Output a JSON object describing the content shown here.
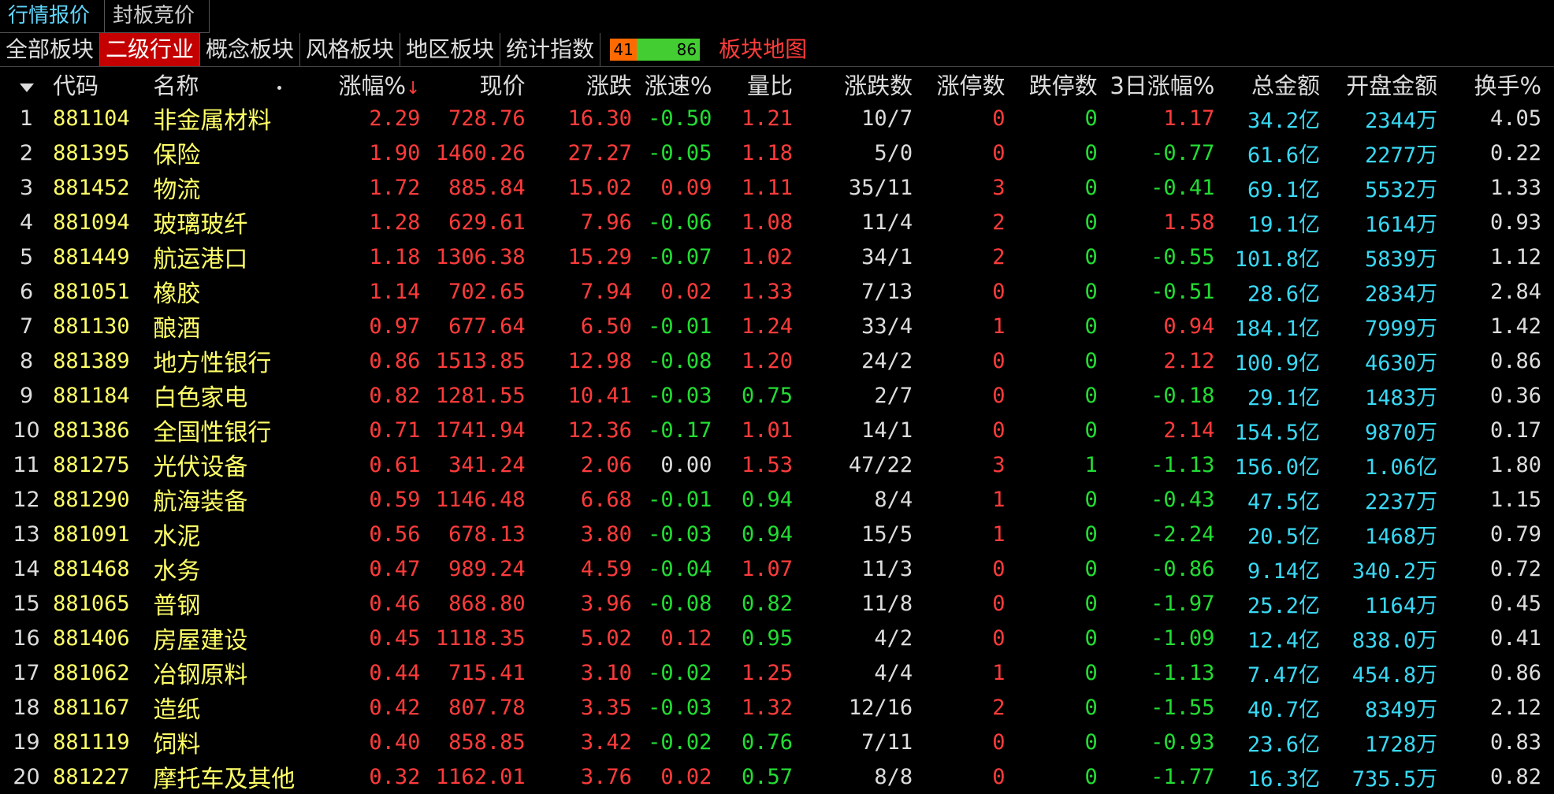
{
  "top_tabs": [
    "行情报价",
    "封板竞价"
  ],
  "sub_tabs": [
    "全部板块",
    "二级行业",
    "概念板块",
    "风格板块",
    "地区板块",
    "统计指数"
  ],
  "ratio": {
    "up": "41",
    "down": "86"
  },
  "heatmap_link": "板块地图",
  "headers": {
    "code": "代码",
    "name": "名称",
    "chg": "涨幅%",
    "sort_mark": "↓",
    "price": "现价",
    "diff": "涨跌",
    "speed": "涨速%",
    "vr": "量比",
    "ud": "涨跌数",
    "lu": "涨停数",
    "ld": "跌停数",
    "d3": "3日涨幅%",
    "amt": "总金额",
    "open": "开盘金额",
    "turn": "换手%"
  },
  "rows": [
    [
      "1",
      "881104",
      "非金属材料",
      "2.29",
      "728.76",
      "16.30",
      "-0.50",
      "1.21",
      "10/7",
      "0",
      "0",
      "1.17",
      "34.2亿",
      "2344万",
      "4.05"
    ],
    [
      "2",
      "881395",
      "保险",
      "1.90",
      "1460.26",
      "27.27",
      "-0.05",
      "1.18",
      "5/0",
      "0",
      "0",
      "-0.77",
      "61.6亿",
      "2277万",
      "0.22"
    ],
    [
      "3",
      "881452",
      "物流",
      "1.72",
      "885.84",
      "15.02",
      "0.09",
      "1.11",
      "35/11",
      "3",
      "0",
      "-0.41",
      "69.1亿",
      "5532万",
      "1.33"
    ],
    [
      "4",
      "881094",
      "玻璃玻纤",
      "1.28",
      "629.61",
      "7.96",
      "-0.06",
      "1.08",
      "11/4",
      "2",
      "0",
      "1.58",
      "19.1亿",
      "1614万",
      "0.93"
    ],
    [
      "5",
      "881449",
      "航运港口",
      "1.18",
      "1306.38",
      "15.29",
      "-0.07",
      "1.02",
      "34/1",
      "2",
      "0",
      "-0.55",
      "101.8亿",
      "5839万",
      "1.12"
    ],
    [
      "6",
      "881051",
      "橡胶",
      "1.14",
      "702.65",
      "7.94",
      "0.02",
      "1.33",
      "7/13",
      "0",
      "0",
      "-0.51",
      "28.6亿",
      "2834万",
      "2.84"
    ],
    [
      "7",
      "881130",
      "酿酒",
      "0.97",
      "677.64",
      "6.50",
      "-0.01",
      "1.24",
      "33/4",
      "1",
      "0",
      "0.94",
      "184.1亿",
      "7999万",
      "1.42"
    ],
    [
      "8",
      "881389",
      "地方性银行",
      "0.86",
      "1513.85",
      "12.98",
      "-0.08",
      "1.20",
      "24/2",
      "0",
      "0",
      "2.12",
      "100.9亿",
      "4630万",
      "0.86"
    ],
    [
      "9",
      "881184",
      "白色家电",
      "0.82",
      "1281.55",
      "10.41",
      "-0.03",
      "0.75",
      "2/7",
      "0",
      "0",
      "-0.18",
      "29.1亿",
      "1483万",
      "0.36"
    ],
    [
      "10",
      "881386",
      "全国性银行",
      "0.71",
      "1741.94",
      "12.36",
      "-0.17",
      "1.01",
      "14/1",
      "0",
      "0",
      "2.14",
      "154.5亿",
      "9870万",
      "0.17"
    ],
    [
      "11",
      "881275",
      "光伏设备",
      "0.61",
      "341.24",
      "2.06",
      "0.00",
      "1.53",
      "47/22",
      "3",
      "1",
      "-1.13",
      "156.0亿",
      "1.06亿",
      "1.80"
    ],
    [
      "12",
      "881290",
      "航海装备",
      "0.59",
      "1146.48",
      "6.68",
      "-0.01",
      "0.94",
      "8/4",
      "1",
      "0",
      "-0.43",
      "47.5亿",
      "2237万",
      "1.15"
    ],
    [
      "13",
      "881091",
      "水泥",
      "0.56",
      "678.13",
      "3.80",
      "-0.03",
      "0.94",
      "15/5",
      "1",
      "0",
      "-2.24",
      "20.5亿",
      "1468万",
      "0.79"
    ],
    [
      "14",
      "881468",
      "水务",
      "0.47",
      "989.24",
      "4.59",
      "-0.04",
      "1.07",
      "11/3",
      "0",
      "0",
      "-0.86",
      "9.14亿",
      "340.2万",
      "0.72"
    ],
    [
      "15",
      "881065",
      "普钢",
      "0.46",
      "868.80",
      "3.96",
      "-0.08",
      "0.82",
      "11/8",
      "0",
      "0",
      "-1.97",
      "25.2亿",
      "1164万",
      "0.45"
    ],
    [
      "16",
      "881406",
      "房屋建设",
      "0.45",
      "1118.35",
      "5.02",
      "0.12",
      "0.95",
      "4/2",
      "0",
      "0",
      "-1.09",
      "12.4亿",
      "838.0万",
      "0.41"
    ],
    [
      "17",
      "881062",
      "冶钢原料",
      "0.44",
      "715.41",
      "3.10",
      "-0.02",
      "1.25",
      "4/4",
      "1",
      "0",
      "-1.13",
      "7.47亿",
      "454.8万",
      "0.86"
    ],
    [
      "18",
      "881167",
      "造纸",
      "0.42",
      "807.78",
      "3.35",
      "-0.03",
      "1.32",
      "12/16",
      "2",
      "0",
      "-1.55",
      "40.7亿",
      "8349万",
      "2.12"
    ],
    [
      "19",
      "881119",
      "饲料",
      "0.40",
      "858.85",
      "3.42",
      "-0.02",
      "0.76",
      "7/11",
      "0",
      "0",
      "-0.93",
      "23.6亿",
      "1728万",
      "0.83"
    ],
    [
      "20",
      "881227",
      "摩托车及其他",
      "0.32",
      "1162.01",
      "3.76",
      "0.02",
      "0.57",
      "8/8",
      "0",
      "0",
      "-1.77",
      "16.3亿",
      "735.5万",
      "0.82"
    ]
  ]
}
